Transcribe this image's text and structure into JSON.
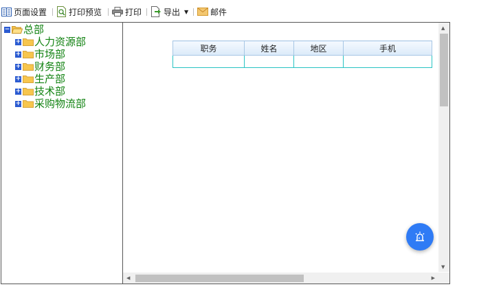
{
  "toolbar": {
    "page_setup": "页面设置",
    "print_preview": "打印预览",
    "print": "打印",
    "export": "导出",
    "mail": "邮件"
  },
  "tree": {
    "root": "总部",
    "children": [
      "人力资源部",
      "市场部",
      "财务部",
      "生产部",
      "技术部",
      "采购物流部"
    ]
  },
  "table": {
    "headers": [
      "职务",
      "姓名",
      "地区",
      "手机"
    ],
    "rows": [
      [
        "",
        "",
        "",
        ""
      ]
    ]
  },
  "icons": {
    "fab": "alarm-icon"
  },
  "colors": {
    "tree_text": "#118211",
    "accent": "#2f7bf5",
    "header_bg": "#dbeaf9",
    "cell_border": "#27c3c3"
  }
}
